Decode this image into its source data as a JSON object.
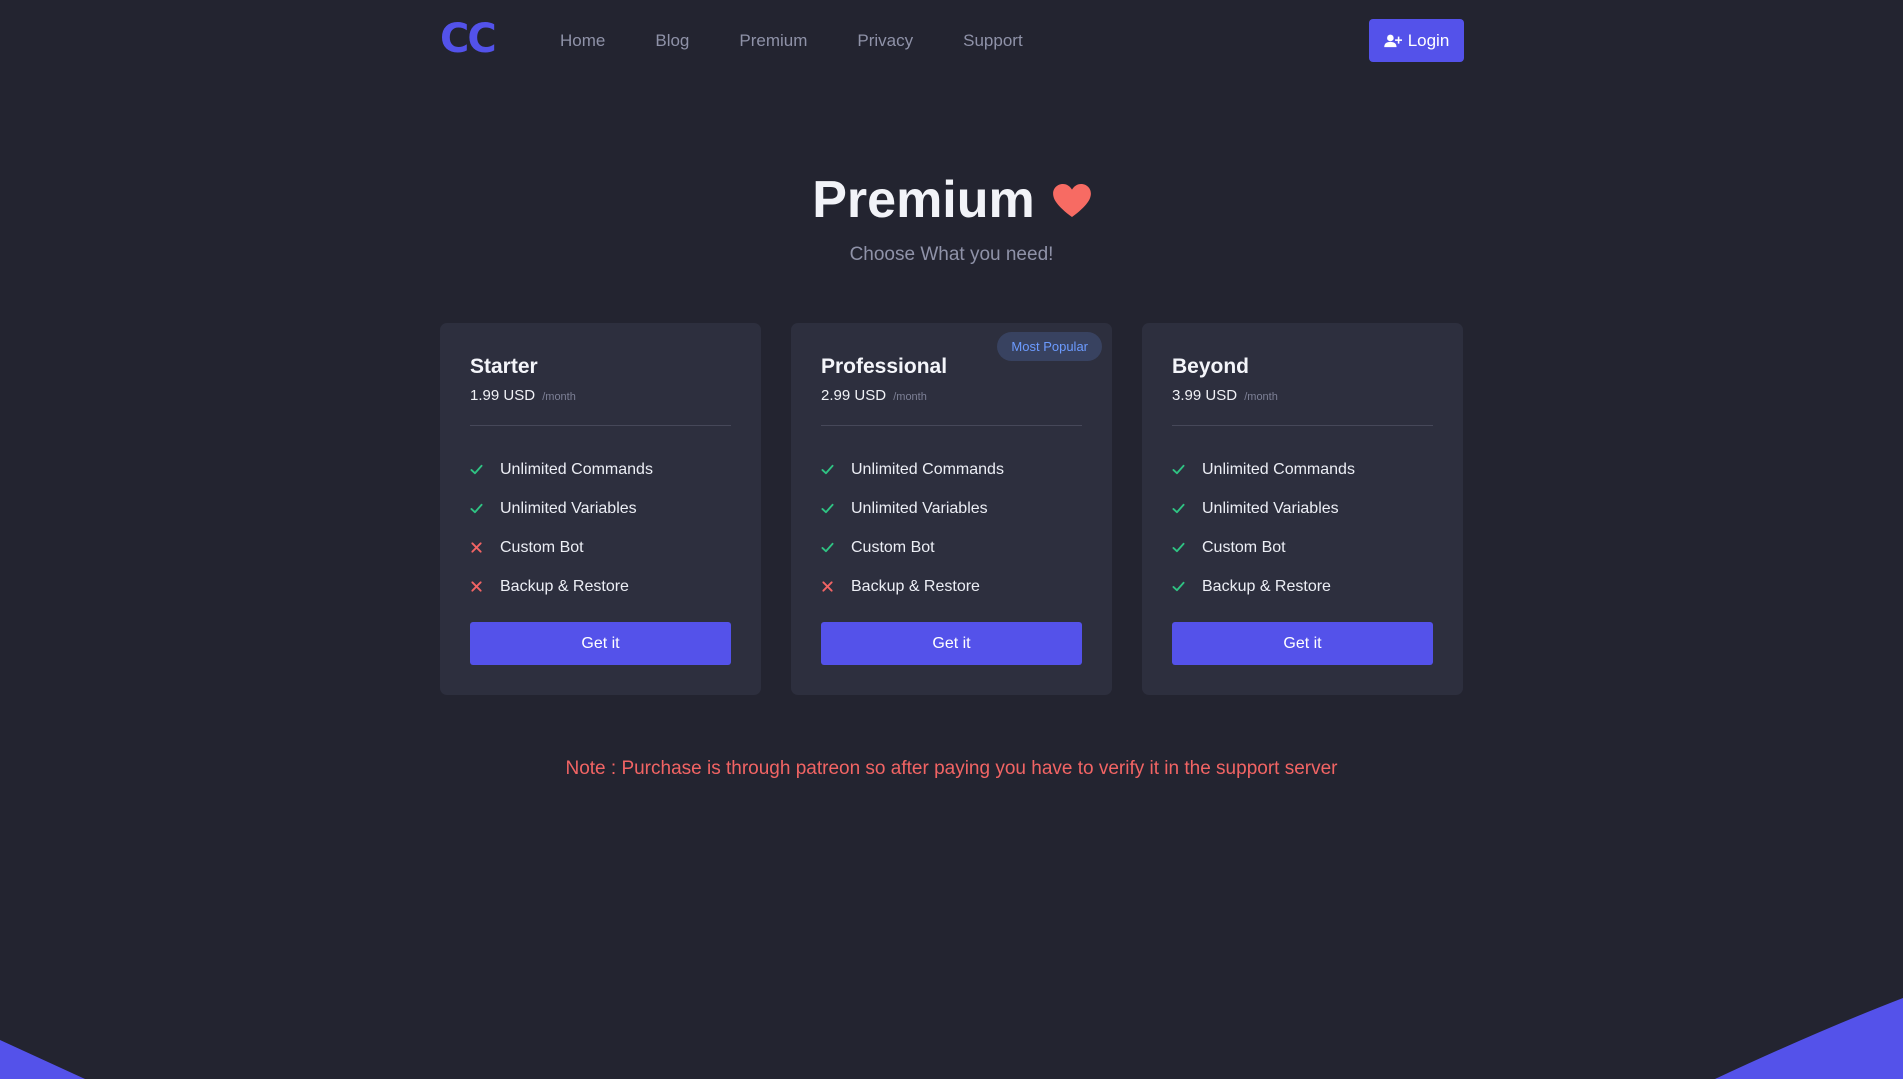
{
  "nav": {
    "logo": "CC",
    "links": [
      "Home",
      "Blog",
      "Premium",
      "Privacy",
      "Support"
    ],
    "login_label": "Login"
  },
  "hero": {
    "title": "Premium",
    "subtitle": "Choose What you need!"
  },
  "plans": [
    {
      "name": "Starter",
      "price": "1.99 USD",
      "period": "/month",
      "badge": "",
      "features": [
        {
          "label": "Unlimited Commands",
          "included": true
        },
        {
          "label": "Unlimited Variables",
          "included": true
        },
        {
          "label": "Custom Bot",
          "included": false
        },
        {
          "label": "Backup & Restore",
          "included": false
        }
      ],
      "cta": "Get it"
    },
    {
      "name": "Professional",
      "price": "2.99 USD",
      "period": "/month",
      "badge": "Most Popular",
      "features": [
        {
          "label": "Unlimited Commands",
          "included": true
        },
        {
          "label": "Unlimited Variables",
          "included": true
        },
        {
          "label": "Custom Bot",
          "included": true
        },
        {
          "label": "Backup & Restore",
          "included": false
        }
      ],
      "cta": "Get it"
    },
    {
      "name": "Beyond",
      "price": "3.99 USD",
      "period": "/month",
      "badge": "",
      "features": [
        {
          "label": "Unlimited Commands",
          "included": true
        },
        {
          "label": "Unlimited Variables",
          "included": true
        },
        {
          "label": "Custom Bot",
          "included": true
        },
        {
          "label": "Backup & Restore",
          "included": true
        }
      ],
      "cta": "Get it"
    }
  ],
  "note": "Note : Purchase is through patreon so after paying you have to verify it in the support server",
  "colors": {
    "background": "#232430",
    "card": "#2d2f3e",
    "accent": "#5452ea",
    "check": "#2fc383",
    "cross": "#f26464",
    "heart": "#f76b63"
  }
}
